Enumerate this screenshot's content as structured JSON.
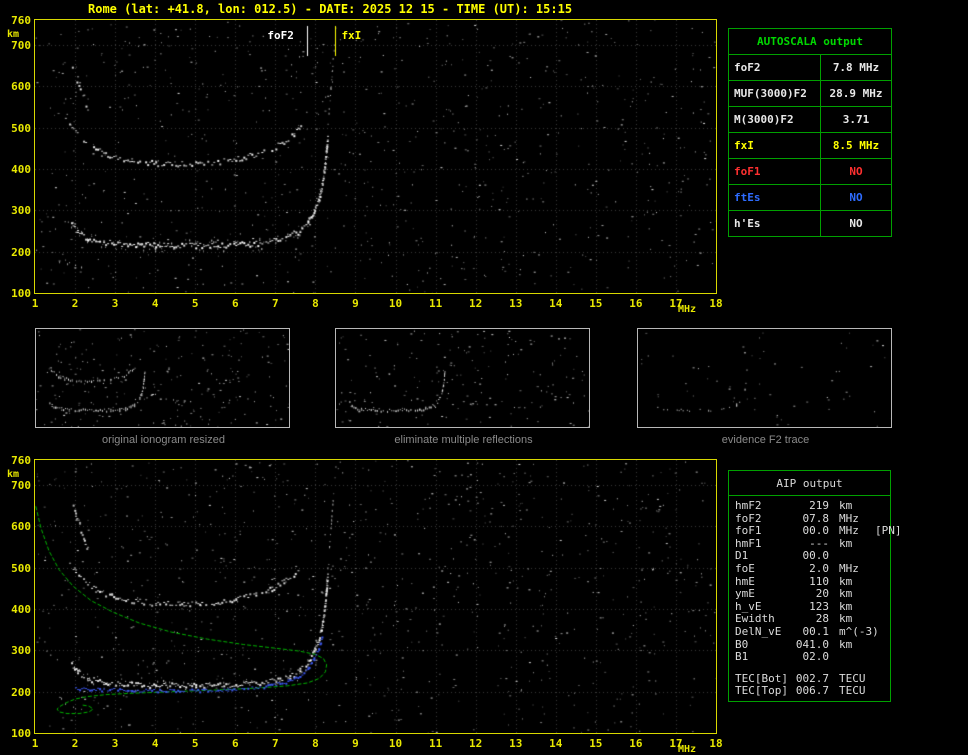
{
  "header": {
    "title": "Rome (lat: +41.8, lon: 012.5) - DATE: 2025 12 15 - TIME (UT): 15:15"
  },
  "colors": {
    "accent_yellow": "#ffff00",
    "table_green": "#00a000",
    "status_red": "#ff3030",
    "status_blue": "#2e6cff",
    "data_white": "#e8e8e8",
    "caption_gray": "#8a8a8a",
    "profile_green": "#00b400",
    "trace_blue": "#3a55e8"
  },
  "main_plot": {
    "fof2_label": "foF2",
    "fxi_label": "fxI",
    "unit_x": "MHz",
    "unit_y": "km"
  },
  "bottom_plot": {
    "unit_x": "MHz",
    "unit_y": "km"
  },
  "autoscala": {
    "header": "AUTOSCALA output",
    "rows": [
      {
        "label": "foF2",
        "value": "7.8 MHz",
        "color": "white"
      },
      {
        "label": "MUF(3000)F2",
        "value": "28.9 MHz",
        "color": "white"
      },
      {
        "label": "M(3000)F2",
        "value": "3.71",
        "color": "white"
      },
      {
        "label": "fxI",
        "value": "8.5 MHz",
        "color": "yellow"
      },
      {
        "label": "foF1",
        "value": "NO",
        "color": "red"
      },
      {
        "label": "ftEs",
        "value": "NO",
        "color": "blue"
      },
      {
        "label": "h'Es",
        "value": "NO",
        "color": "white"
      }
    ]
  },
  "thumbnails": [
    {
      "caption": "original ionogram resized"
    },
    {
      "caption": "eliminate multiple reflections"
    },
    {
      "caption": "evidence F2 trace"
    }
  ],
  "aip": {
    "header": "AIP output",
    "rows": [
      {
        "name": "hmF2",
        "value": "219",
        "unit": "km",
        "extra": ""
      },
      {
        "name": "foF2",
        "value": "07.8",
        "unit": "MHz",
        "extra": ""
      },
      {
        "name": "foF1",
        "value": "00.0",
        "unit": "MHz",
        "extra": "[PN]"
      },
      {
        "name": "hmF1",
        "value": "---",
        "unit": "km",
        "extra": ""
      },
      {
        "name": "D1",
        "value": "00.0",
        "unit": "",
        "extra": ""
      },
      {
        "name": "foE",
        "value": "2.0",
        "unit": "MHz",
        "extra": ""
      },
      {
        "name": "hmE",
        "value": "110",
        "unit": "km",
        "extra": ""
      },
      {
        "name": "ymE",
        "value": "20",
        "unit": "km",
        "extra": ""
      },
      {
        "name": "h_vE",
        "value": "123",
        "unit": "km",
        "extra": ""
      },
      {
        "name": "Ewidth",
        "value": "28",
        "unit": "km",
        "extra": ""
      },
      {
        "name": "DelN_vE",
        "value": "00.1",
        "unit": "m^(-3)",
        "extra": ""
      },
      {
        "name": "B0",
        "value": "041.0",
        "unit": "km",
        "extra": ""
      },
      {
        "name": "B1",
        "value": "02.0",
        "unit": "",
        "extra": ""
      }
    ],
    "tec_rows": [
      {
        "name": "TEC[Bot]",
        "value": "002.7",
        "unit": "TECU"
      },
      {
        "name": "TEC[Top]",
        "value": "006.7",
        "unit": "TECU"
      }
    ]
  },
  "chart_data": {
    "type": "scatter",
    "title": "Rome ionogram 2025-12-15 15:15 UT",
    "xlabel": "MHz",
    "ylabel": "km",
    "x_range": [
      1,
      18
    ],
    "y_range": [
      100,
      760
    ],
    "x_ticks": [
      1,
      2,
      3,
      4,
      5,
      6,
      7,
      8,
      9,
      10,
      11,
      12,
      13,
      14,
      15,
      16,
      17,
      18
    ],
    "y_ticks": [
      760,
      700,
      600,
      500,
      400,
      300,
      200,
      100
    ],
    "grid": "dotted",
    "markers": {
      "foF2_MHz": 7.8,
      "fxI_MHz": 8.5
    },
    "scaled_values": {
      "foF2": 7.8,
      "fxI": 8.5,
      "MUF3000F2": 28.9,
      "M3000F2": 3.71,
      "hmF2": 219
    },
    "traces": {
      "f2_first_hop": [
        [
          1.9,
          268
        ],
        [
          2.05,
          248
        ],
        [
          2.3,
          232
        ],
        [
          2.7,
          224
        ],
        [
          3.2,
          219
        ],
        [
          4.0,
          217
        ],
        [
          5.0,
          216
        ],
        [
          6.0,
          218
        ],
        [
          6.6,
          222
        ],
        [
          7.0,
          228
        ],
        [
          7.35,
          238
        ],
        [
          7.6,
          252
        ],
        [
          7.8,
          272
        ],
        [
          7.95,
          298
        ],
        [
          8.08,
          330
        ],
        [
          8.16,
          365
        ],
        [
          8.22,
          405
        ],
        [
          8.26,
          445
        ],
        [
          8.29,
          480
        ]
      ],
      "f2_second_hop": [
        [
          1.85,
          515
        ],
        [
          2.0,
          492
        ],
        [
          2.2,
          468
        ],
        [
          2.5,
          448
        ],
        [
          2.9,
          432
        ],
        [
          3.4,
          421
        ],
        [
          4.0,
          415
        ],
        [
          4.7,
          413
        ],
        [
          5.4,
          416
        ],
        [
          6.0,
          424
        ],
        [
          6.5,
          436
        ],
        [
          6.9,
          450
        ],
        [
          7.2,
          466
        ],
        [
          7.45,
          486
        ],
        [
          7.62,
          508
        ]
      ],
      "upper_left_spread": [
        [
          1.9,
          655
        ],
        [
          2.0,
          630
        ],
        [
          2.1,
          602
        ],
        [
          2.2,
          575
        ],
        [
          2.3,
          550
        ]
      ],
      "asymptote_spread": [
        [
          8.3,
          500
        ],
        [
          8.34,
          550
        ],
        [
          8.38,
          600
        ],
        [
          8.42,
          650
        ],
        [
          8.46,
          700
        ],
        [
          8.5,
          745
        ]
      ],
      "lower_left_cluster": [
        [
          1.6,
          185
        ],
        [
          1.75,
          172
        ],
        [
          1.95,
          162
        ],
        [
          2.15,
          158
        ]
      ],
      "blue_scaled_trace": [
        [
          2.0,
          210
        ],
        [
          2.6,
          206
        ],
        [
          3.4,
          204
        ],
        [
          4.2,
          203
        ],
        [
          5.0,
          204
        ],
        [
          5.8,
          206
        ],
        [
          6.4,
          210
        ],
        [
          6.9,
          216
        ],
        [
          7.3,
          226
        ],
        [
          7.6,
          240
        ],
        [
          7.8,
          258
        ],
        [
          7.95,
          280
        ],
        [
          8.07,
          305
        ],
        [
          8.15,
          330
        ]
      ],
      "green_profile": [
        [
          1.02,
          648
        ],
        [
          1.15,
          595
        ],
        [
          1.35,
          540
        ],
        [
          1.6,
          495
        ],
        [
          1.95,
          455
        ],
        [
          2.4,
          420
        ],
        [
          2.95,
          392
        ],
        [
          3.6,
          366
        ],
        [
          4.4,
          344
        ],
        [
          5.3,
          327
        ],
        [
          6.2,
          314
        ],
        [
          7.0,
          305
        ],
        [
          7.6,
          298
        ],
        [
          8.0,
          290
        ],
        [
          8.2,
          280
        ],
        [
          8.28,
          265
        ],
        [
          8.25,
          248
        ],
        [
          8.1,
          232
        ],
        [
          7.8,
          221
        ],
        [
          7.3,
          214
        ],
        [
          6.6,
          209
        ],
        [
          5.8,
          205
        ],
        [
          5.0,
          202
        ],
        [
          4.2,
          199
        ],
        [
          3.4,
          196
        ],
        [
          2.8,
          193
        ],
        [
          2.3,
          188
        ],
        [
          2.0,
          182
        ],
        [
          1.8,
          174
        ],
        [
          1.65,
          166
        ],
        [
          1.55,
          158
        ],
        [
          1.6,
          151
        ],
        [
          1.8,
          147
        ],
        [
          2.1,
          147
        ],
        [
          2.35,
          151
        ],
        [
          2.45,
          158
        ],
        [
          2.35,
          165
        ],
        [
          2.15,
          168
        ]
      ]
    }
  }
}
